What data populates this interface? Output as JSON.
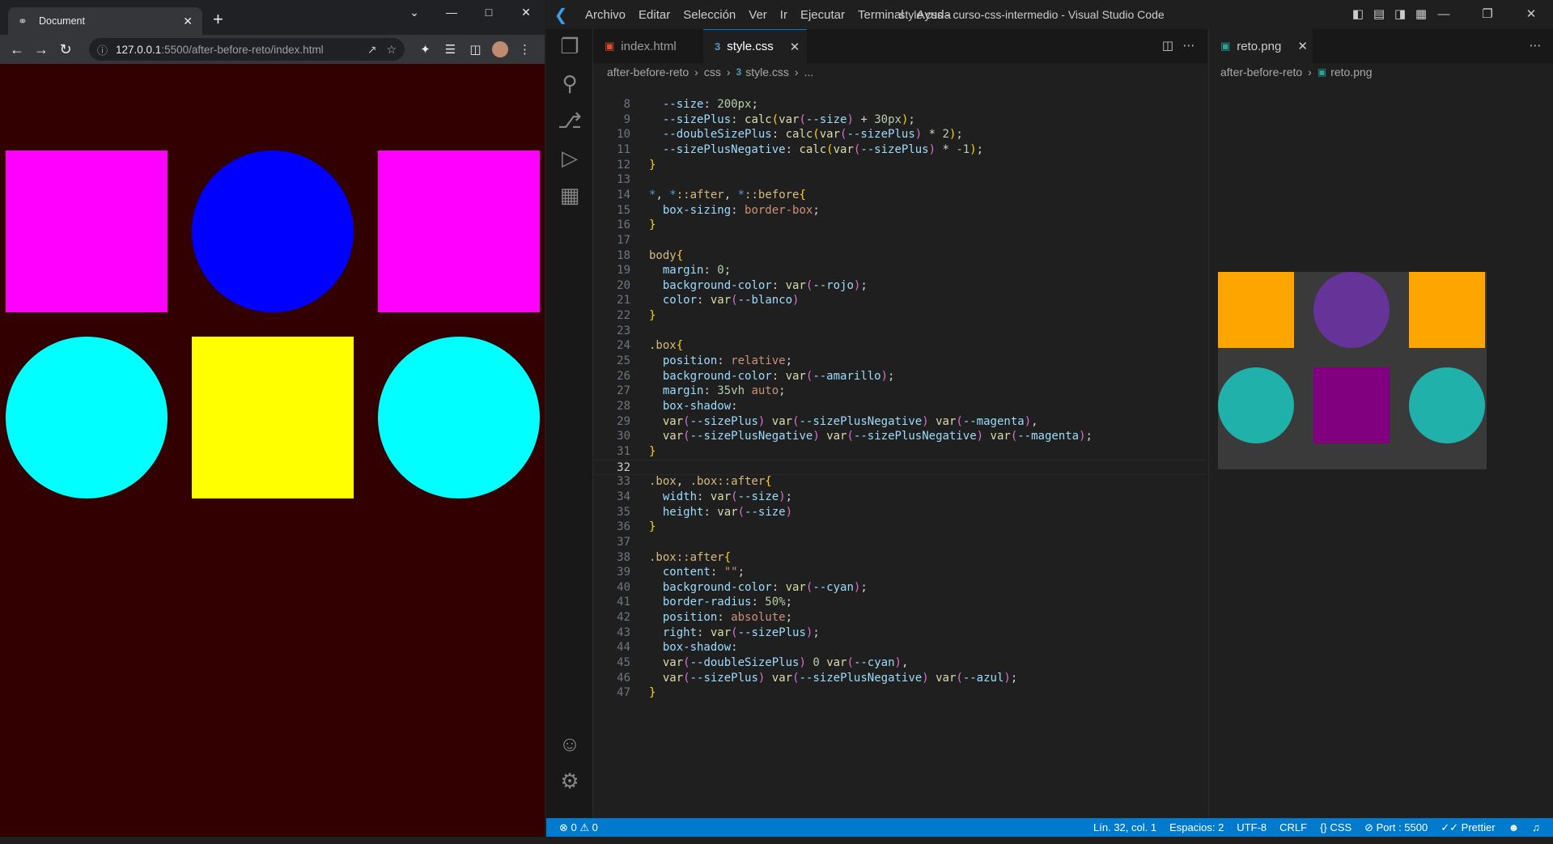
{
  "browser": {
    "tab_title": "Document",
    "url_host": "127.0.0.1",
    "url_rest": ":5500/after-before-reto/index.html",
    "page_bg": "#330000",
    "shapes": [
      {
        "kind": "square",
        "color": "#ff00ff"
      },
      {
        "kind": "circle",
        "color": "#0000ff"
      },
      {
        "kind": "square",
        "color": "#ff00ff"
      },
      {
        "kind": "circle",
        "color": "#00ffff"
      },
      {
        "kind": "square",
        "color": "#ffff00"
      },
      {
        "kind": "circle",
        "color": "#00ffff"
      }
    ]
  },
  "vscode": {
    "menu": [
      "Archivo",
      "Editar",
      "Selección",
      "Ver",
      "Ir",
      "Ejecutar",
      "Terminal",
      "Ayuda"
    ],
    "window_title": "style.css - curso-css-intermedio - Visual Studio Code",
    "tabs": [
      {
        "label": "index.html",
        "icon": "html5-icon"
      },
      {
        "label": "style.css",
        "icon": "css-icon"
      }
    ],
    "breadcrumb": [
      "after-before-reto",
      "css",
      "style.css",
      "..."
    ],
    "image_tab": "reto.png",
    "image_breadcrumb": [
      "after-before-reto",
      "reto.png"
    ],
    "image_shapes": [
      {
        "kind": "square",
        "color": "#ffa500"
      },
      {
        "kind": "circle",
        "color": "#663399"
      },
      {
        "kind": "square",
        "color": "#ffa500"
      },
      {
        "kind": "circle",
        "color": "#20b2aa"
      },
      {
        "kind": "square",
        "color": "#800080"
      },
      {
        "kind": "circle",
        "color": "#20b2aa"
      }
    ],
    "current_line": 32,
    "code": [
      {
        "n": 8,
        "t": [
          [
            "p",
            "  --size"
          ],
          [
            "c",
            ": "
          ],
          [
            "n",
            "200px"
          ],
          [
            "c",
            ";"
          ]
        ]
      },
      {
        "n": 9,
        "t": [
          [
            "p",
            "  --sizePlus"
          ],
          [
            "c",
            ": "
          ],
          [
            "f",
            "calc"
          ],
          [
            "b1",
            "("
          ],
          [
            "f",
            "var"
          ],
          [
            "b2",
            "("
          ],
          [
            "p",
            "--size"
          ],
          [
            "b2",
            ")"
          ],
          [
            "c",
            " + "
          ],
          [
            "n",
            "30px"
          ],
          [
            "b1",
            ")"
          ],
          [
            "c",
            ";"
          ]
        ]
      },
      {
        "n": 10,
        "t": [
          [
            "p",
            "  --doubleSizePlus"
          ],
          [
            "c",
            ": "
          ],
          [
            "f",
            "calc"
          ],
          [
            "b1",
            "("
          ],
          [
            "f",
            "var"
          ],
          [
            "b2",
            "("
          ],
          [
            "p",
            "--sizePlus"
          ],
          [
            "b2",
            ")"
          ],
          [
            "c",
            " * "
          ],
          [
            "n",
            "2"
          ],
          [
            "b1",
            ")"
          ],
          [
            "c",
            ";"
          ]
        ]
      },
      {
        "n": 11,
        "t": [
          [
            "p",
            "  --sizePlusNegative"
          ],
          [
            "c",
            ": "
          ],
          [
            "f",
            "calc"
          ],
          [
            "b1",
            "("
          ],
          [
            "f",
            "var"
          ],
          [
            "b2",
            "("
          ],
          [
            "p",
            "--sizePlus"
          ],
          [
            "b2",
            ")"
          ],
          [
            "c",
            " * "
          ],
          [
            "n",
            "-1"
          ],
          [
            "b1",
            ")"
          ],
          [
            "c",
            ";"
          ]
        ]
      },
      {
        "n": 12,
        "t": [
          [
            "b1",
            "}"
          ]
        ]
      },
      {
        "n": 13,
        "t": []
      },
      {
        "n": 14,
        "t": [
          [
            "k",
            "*"
          ],
          [
            "c",
            ", "
          ],
          [
            "k",
            "*"
          ],
          [
            "s",
            "::after"
          ],
          [
            "c",
            ", "
          ],
          [
            "k",
            "*"
          ],
          [
            "s",
            "::before"
          ],
          [
            "b1",
            "{"
          ]
        ]
      },
      {
        "n": 15,
        "t": [
          [
            "p",
            "  box-sizing"
          ],
          [
            "c",
            ": "
          ],
          [
            "v",
            "border-box"
          ],
          [
            "c",
            ";"
          ]
        ]
      },
      {
        "n": 16,
        "t": [
          [
            "b1",
            "}"
          ]
        ]
      },
      {
        "n": 17,
        "t": []
      },
      {
        "n": 18,
        "t": [
          [
            "s",
            "body"
          ],
          [
            "b1",
            "{"
          ]
        ]
      },
      {
        "n": 19,
        "t": [
          [
            "p",
            "  margin"
          ],
          [
            "c",
            ": "
          ],
          [
            "n",
            "0"
          ],
          [
            "c",
            ";"
          ]
        ]
      },
      {
        "n": 20,
        "t": [
          [
            "p",
            "  background-color"
          ],
          [
            "c",
            ": "
          ],
          [
            "f",
            "var"
          ],
          [
            "b2",
            "("
          ],
          [
            "p",
            "--rojo"
          ],
          [
            "b2",
            ")"
          ],
          [
            "c",
            ";"
          ]
        ]
      },
      {
        "n": 21,
        "t": [
          [
            "p",
            "  color"
          ],
          [
            "c",
            ": "
          ],
          [
            "f",
            "var"
          ],
          [
            "b2",
            "("
          ],
          [
            "p",
            "--blanco"
          ],
          [
            "b2",
            ")"
          ]
        ]
      },
      {
        "n": 22,
        "t": [
          [
            "b1",
            "}"
          ]
        ]
      },
      {
        "n": 23,
        "t": []
      },
      {
        "n": 24,
        "t": [
          [
            "s",
            ".box"
          ],
          [
            "b1",
            "{"
          ]
        ]
      },
      {
        "n": 25,
        "t": [
          [
            "p",
            "  position"
          ],
          [
            "c",
            ": "
          ],
          [
            "v",
            "relative"
          ],
          [
            "c",
            ";"
          ]
        ]
      },
      {
        "n": 26,
        "t": [
          [
            "p",
            "  background-color"
          ],
          [
            "c",
            ": "
          ],
          [
            "f",
            "var"
          ],
          [
            "b2",
            "("
          ],
          [
            "p",
            "--amarillo"
          ],
          [
            "b2",
            ")"
          ],
          [
            "c",
            ";"
          ]
        ]
      },
      {
        "n": 27,
        "t": [
          [
            "p",
            "  margin"
          ],
          [
            "c",
            ": "
          ],
          [
            "n",
            "35vh"
          ],
          [
            "c",
            " "
          ],
          [
            "v",
            "auto"
          ],
          [
            "c",
            ";"
          ]
        ]
      },
      {
        "n": 28,
        "t": [
          [
            "p",
            "  box-shadow"
          ],
          [
            "c",
            ":"
          ]
        ]
      },
      {
        "n": 29,
        "t": [
          [
            "c",
            "  "
          ],
          [
            "f",
            "var"
          ],
          [
            "b2",
            "("
          ],
          [
            "p",
            "--sizePlus"
          ],
          [
            "b2",
            ")"
          ],
          [
            "c",
            " "
          ],
          [
            "f",
            "var"
          ],
          [
            "b2",
            "("
          ],
          [
            "p",
            "--sizePlusNegative"
          ],
          [
            "b2",
            ")"
          ],
          [
            "c",
            " "
          ],
          [
            "f",
            "var"
          ],
          [
            "b2",
            "("
          ],
          [
            "p",
            "--magenta"
          ],
          [
            "b2",
            ")"
          ],
          [
            "c",
            ","
          ]
        ]
      },
      {
        "n": 30,
        "t": [
          [
            "c",
            "  "
          ],
          [
            "f",
            "var"
          ],
          [
            "b2",
            "("
          ],
          [
            "p",
            "--sizePlusNegative"
          ],
          [
            "b2",
            ")"
          ],
          [
            "c",
            " "
          ],
          [
            "f",
            "var"
          ],
          [
            "b2",
            "("
          ],
          [
            "p",
            "--sizePlusNegative"
          ],
          [
            "b2",
            ")"
          ],
          [
            "c",
            " "
          ],
          [
            "f",
            "var"
          ],
          [
            "b2",
            "("
          ],
          [
            "p",
            "--magenta"
          ],
          [
            "b2",
            ")"
          ],
          [
            "c",
            ";"
          ]
        ]
      },
      {
        "n": 31,
        "t": [
          [
            "b1",
            "}"
          ]
        ]
      },
      {
        "n": 32,
        "t": []
      },
      {
        "n": 33,
        "t": [
          [
            "s",
            ".box"
          ],
          [
            "c",
            ", "
          ],
          [
            "s",
            ".box::after"
          ],
          [
            "b1",
            "{"
          ]
        ]
      },
      {
        "n": 34,
        "t": [
          [
            "p",
            "  width"
          ],
          [
            "c",
            ": "
          ],
          [
            "f",
            "var"
          ],
          [
            "b2",
            "("
          ],
          [
            "p",
            "--size"
          ],
          [
            "b2",
            ")"
          ],
          [
            "c",
            ";"
          ]
        ]
      },
      {
        "n": 35,
        "t": [
          [
            "p",
            "  height"
          ],
          [
            "c",
            ": "
          ],
          [
            "f",
            "var"
          ],
          [
            "b2",
            "("
          ],
          [
            "p",
            "--size"
          ],
          [
            "b2",
            ")"
          ]
        ]
      },
      {
        "n": 36,
        "t": [
          [
            "b1",
            "}"
          ]
        ]
      },
      {
        "n": 37,
        "t": []
      },
      {
        "n": 38,
        "t": [
          [
            "s",
            ".box::after"
          ],
          [
            "b1",
            "{"
          ]
        ]
      },
      {
        "n": 39,
        "t": [
          [
            "p",
            "  content"
          ],
          [
            "c",
            ": "
          ],
          [
            "v",
            "\"\""
          ],
          [
            "c",
            ";"
          ]
        ]
      },
      {
        "n": 40,
        "t": [
          [
            "p",
            "  background-color"
          ],
          [
            "c",
            ": "
          ],
          [
            "f",
            "var"
          ],
          [
            "b2",
            "("
          ],
          [
            "p",
            "--cyan"
          ],
          [
            "b2",
            ")"
          ],
          [
            "c",
            ";"
          ]
        ]
      },
      {
        "n": 41,
        "t": [
          [
            "p",
            "  border-radius"
          ],
          [
            "c",
            ": "
          ],
          [
            "n",
            "50%"
          ],
          [
            "c",
            ";"
          ]
        ]
      },
      {
        "n": 42,
        "t": [
          [
            "p",
            "  position"
          ],
          [
            "c",
            ": "
          ],
          [
            "v",
            "absolute"
          ],
          [
            "c",
            ";"
          ]
        ]
      },
      {
        "n": 43,
        "t": [
          [
            "p",
            "  right"
          ],
          [
            "c",
            ": "
          ],
          [
            "f",
            "var"
          ],
          [
            "b2",
            "("
          ],
          [
            "p",
            "--sizePlus"
          ],
          [
            "b2",
            ")"
          ],
          [
            "c",
            ";"
          ]
        ]
      },
      {
        "n": 44,
        "t": [
          [
            "p",
            "  box-shadow"
          ],
          [
            "c",
            ":"
          ]
        ]
      },
      {
        "n": 45,
        "t": [
          [
            "c",
            "  "
          ],
          [
            "f",
            "var"
          ],
          [
            "b2",
            "("
          ],
          [
            "p",
            "--doubleSizePlus"
          ],
          [
            "b2",
            ")"
          ],
          [
            "c",
            " "
          ],
          [
            "n",
            "0"
          ],
          [
            "c",
            " "
          ],
          [
            "f",
            "var"
          ],
          [
            "b2",
            "("
          ],
          [
            "p",
            "--cyan"
          ],
          [
            "b2",
            ")"
          ],
          [
            "c",
            ","
          ]
        ]
      },
      {
        "n": 46,
        "t": [
          [
            "c",
            "  "
          ],
          [
            "f",
            "var"
          ],
          [
            "b2",
            "("
          ],
          [
            "p",
            "--sizePlus"
          ],
          [
            "b2",
            ")"
          ],
          [
            "c",
            " "
          ],
          [
            "f",
            "var"
          ],
          [
            "b2",
            "("
          ],
          [
            "p",
            "--sizePlusNegative"
          ],
          [
            "b2",
            ")"
          ],
          [
            "c",
            " "
          ],
          [
            "f",
            "var"
          ],
          [
            "b2",
            "("
          ],
          [
            "p",
            "--azul"
          ],
          [
            "b2",
            ")"
          ],
          [
            "c",
            ";"
          ]
        ]
      },
      {
        "n": 47,
        "t": [
          [
            "b1",
            "}"
          ]
        ]
      }
    ],
    "status": {
      "errors": "0",
      "warnings": "0",
      "position": "Lín. 32, col. 1",
      "spaces": "Espacios: 2",
      "encoding": "UTF-8",
      "eol": "CRLF",
      "language": "CSS",
      "port": "Port : 5500",
      "formatter": "Prettier"
    },
    "accent": "#007acc"
  }
}
